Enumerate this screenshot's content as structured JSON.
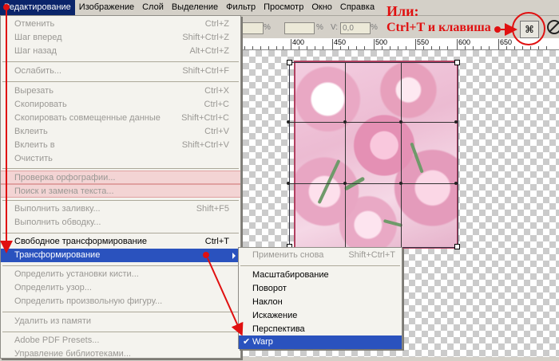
{
  "menubar": {
    "items": [
      "Редактирование",
      "Изображение",
      "Слой",
      "Выделение",
      "Фильтр",
      "Просмотр",
      "Окно",
      "Справка"
    ]
  },
  "options_bar": {
    "pct1": "%",
    "pct2": "%",
    "v_label": "V:",
    "v_value": "0,0",
    "pct3": "%"
  },
  "ruler": {
    "labels": [
      "400",
      "450",
      "500",
      "550",
      "600",
      "650"
    ]
  },
  "edit_menu": {
    "items": [
      {
        "label": "Отменить",
        "shortcut": "Ctrl+Z",
        "disabled": true
      },
      {
        "label": "Шаг вперед",
        "shortcut": "Shift+Ctrl+Z",
        "disabled": true
      },
      {
        "label": "Шаг назад",
        "shortcut": "Alt+Ctrl+Z",
        "disabled": true
      },
      {
        "label": "Ослабить...",
        "shortcut": "Shift+Ctrl+F",
        "disabled": true
      },
      {
        "label": "Вырезать",
        "shortcut": "Ctrl+X",
        "disabled": true
      },
      {
        "label": "Скопировать",
        "shortcut": "Ctrl+C",
        "disabled": true
      },
      {
        "label": "Скопировать совмещенные данные",
        "shortcut": "Shift+Ctrl+C",
        "disabled": true
      },
      {
        "label": "Вклеить",
        "shortcut": "Ctrl+V",
        "disabled": true
      },
      {
        "label": "Вклеить в",
        "shortcut": "Shift+Ctrl+V",
        "disabled": true
      },
      {
        "label": "Очистить",
        "shortcut": "",
        "disabled": true
      },
      {
        "label": "Проверка орфографии...",
        "shortcut": "",
        "disabled": true
      },
      {
        "label": "Поиск и замена текста...",
        "shortcut": "",
        "disabled": true
      },
      {
        "label": "Выполнить заливку...",
        "shortcut": "Shift+F5",
        "disabled": true
      },
      {
        "label": "Выполнить обводку...",
        "shortcut": "",
        "disabled": true
      },
      {
        "label": "Свободное трансформирование",
        "shortcut": "Ctrl+T",
        "disabled": false
      },
      {
        "label": "Трансформирование",
        "shortcut": "",
        "disabled": false
      },
      {
        "label": "Определить установки кисти...",
        "shortcut": "",
        "disabled": true
      },
      {
        "label": "Определить узор...",
        "shortcut": "",
        "disabled": true
      },
      {
        "label": "Определить произвольную фигуру...",
        "shortcut": "",
        "disabled": true
      },
      {
        "label": "Удалить из памяти",
        "shortcut": "",
        "disabled": true
      },
      {
        "label": "Adobe PDF Presets...",
        "shortcut": "",
        "disabled": true
      },
      {
        "label": "Управление библиотеками...",
        "shortcut": "",
        "disabled": true
      }
    ]
  },
  "transform_submenu": {
    "items": [
      {
        "label": "Применить снова",
        "shortcut": "Shift+Ctrl+T",
        "disabled": true
      },
      {
        "label": "Масштабирование",
        "shortcut": "",
        "disabled": false
      },
      {
        "label": "Поворот",
        "shortcut": "",
        "disabled": false
      },
      {
        "label": "Наклон",
        "shortcut": "",
        "disabled": false
      },
      {
        "label": "Искажение",
        "shortcut": "",
        "disabled": false
      },
      {
        "label": "Перспектива",
        "shortcut": "",
        "disabled": false
      },
      {
        "label": "Warp",
        "shortcut": "",
        "disabled": false
      }
    ],
    "check_mark": "✔"
  },
  "annotation": {
    "line1": "Или:",
    "line2": "Ctrl+T и клавиша"
  },
  "colors": {
    "accent": "#e01010",
    "highlight": "#2a52be",
    "menubar_active": "#0a246a"
  },
  "icons": {
    "warp_icon": "warp-mode-icon",
    "cancel_icon": "cancel-transform-icon"
  }
}
